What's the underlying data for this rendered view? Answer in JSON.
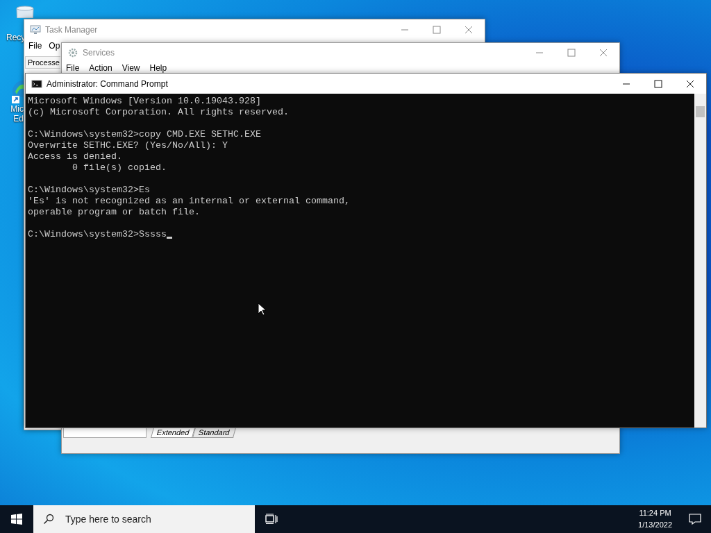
{
  "desktop_icons": [
    {
      "kind": "recycle-bin",
      "lines": [
        "Recy"
      ]
    },
    {
      "kind": "browser",
      "lines": [
        "Mic",
        "Ed"
      ]
    }
  ],
  "task_manager": {
    "title": "Task Manager",
    "menu": [
      "File",
      "Op"
    ],
    "tabs": [
      {
        "label": "Processe",
        "selected": true
      }
    ]
  },
  "services": {
    "title": "Services",
    "menu": [
      "File",
      "Action",
      "View",
      "Help"
    ],
    "tabs": [
      {
        "label": "Extended",
        "selected": true
      },
      {
        "label": "Standard",
        "selected": false
      }
    ]
  },
  "command_prompt": {
    "title": "Administrator: Command Prompt",
    "blocks": [
      [
        "Microsoft Windows [Version 10.0.19043.928]",
        "(c) Microsoft Corporation. All rights reserved."
      ],
      [
        "C:\\Windows\\system32>copy CMD.EXE SETHC.EXE",
        "Overwrite SETHC.EXE? (Yes/No/All): Y",
        "Access is denied.",
        "        0 file(s) copied."
      ],
      [
        "C:\\Windows\\system32>Es",
        "'Es' is not recognized as an internal or external command,",
        "operable program or batch file."
      ],
      [
        "C:\\Windows\\system32>Sssss"
      ]
    ]
  },
  "taskbar": {
    "search": {
      "placeholder": "Type here to search"
    },
    "time": "11:24 PM",
    "date": "1/13/2022"
  }
}
